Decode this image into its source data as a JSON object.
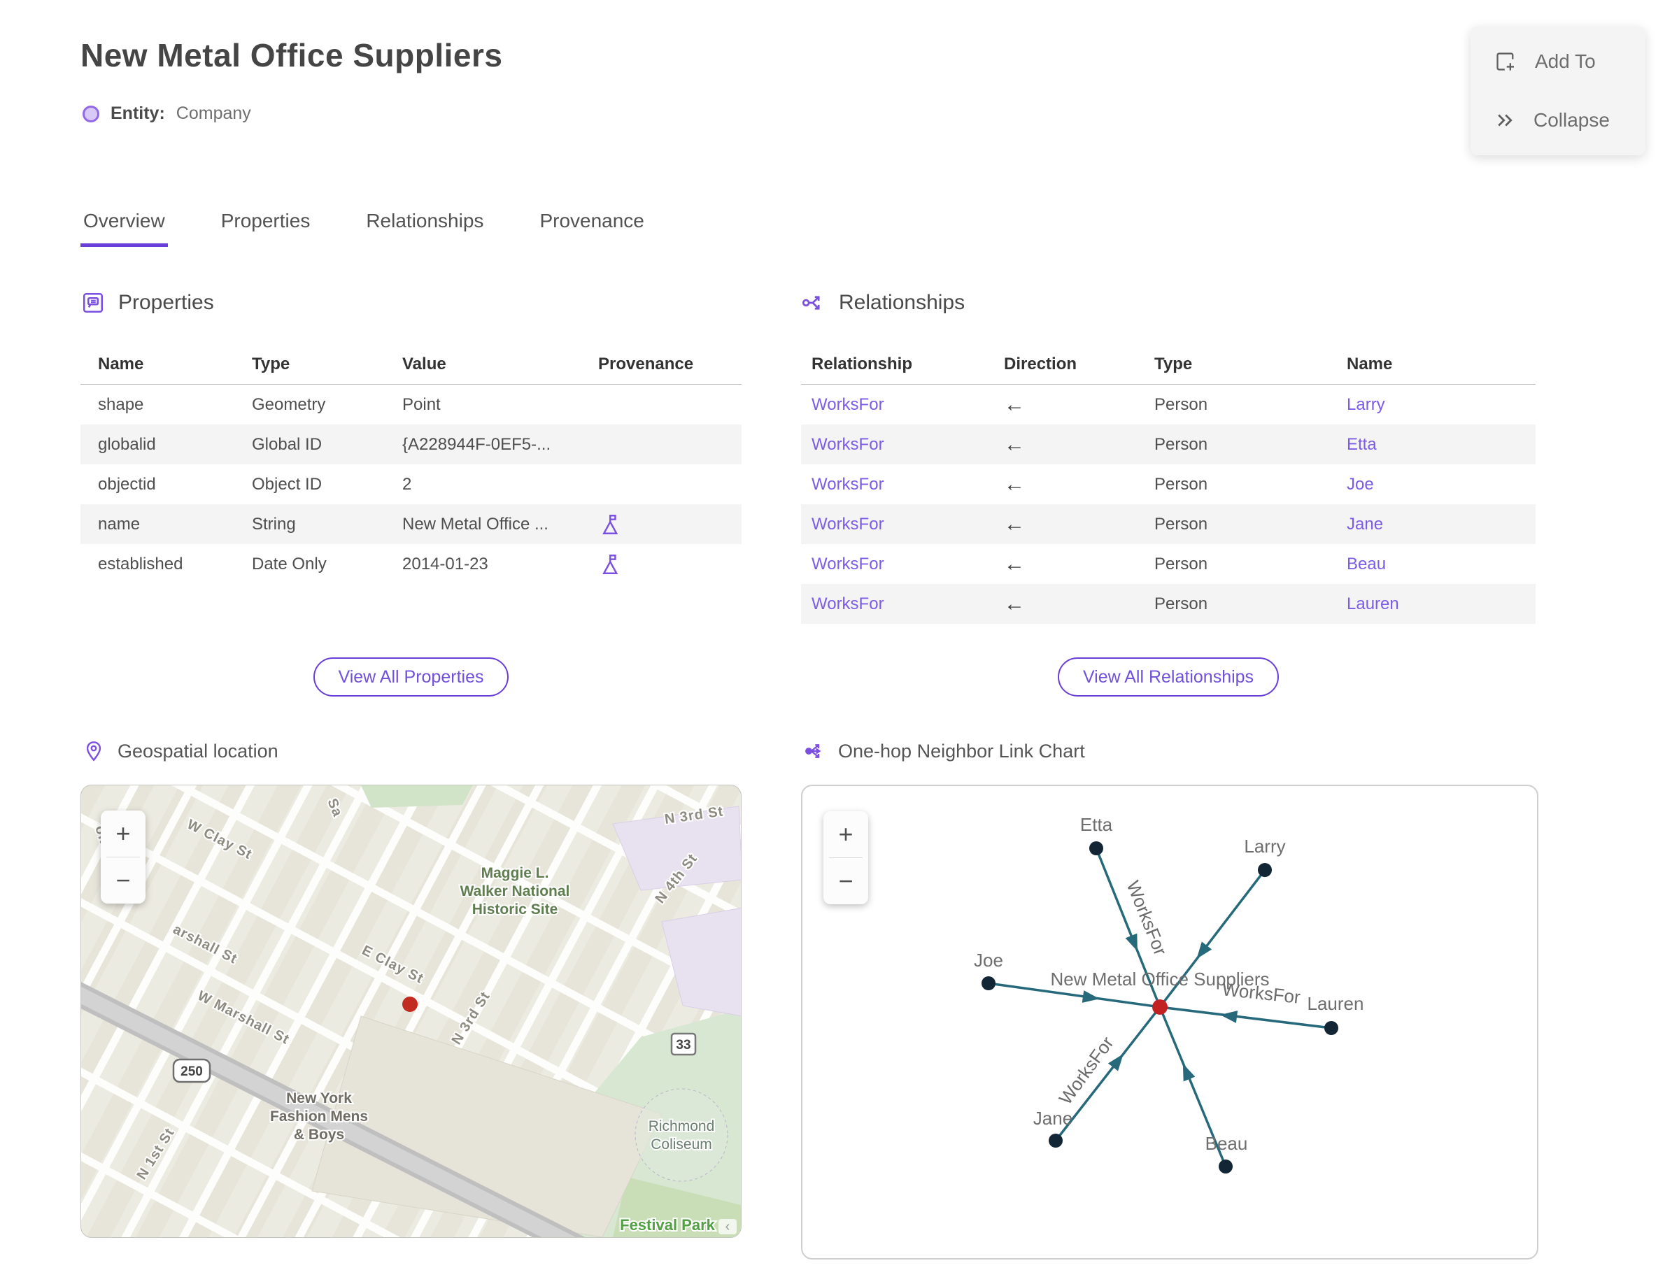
{
  "header": {
    "title": "New Metal Office Suppliers",
    "entity_label": "Entity:",
    "entity_type": "Company"
  },
  "actions": {
    "add_to": "Add To",
    "collapse": "Collapse"
  },
  "tabs": {
    "overview": "Overview",
    "properties": "Properties",
    "relationships": "Relationships",
    "provenance": "Provenance"
  },
  "properties_section": {
    "title": "Properties",
    "columns": {
      "name": "Name",
      "type": "Type",
      "value": "Value",
      "provenance": "Provenance"
    },
    "rows": [
      {
        "name": "shape",
        "type": "Geometry",
        "value": "Point"
      },
      {
        "name": "globalid",
        "type": "Global ID",
        "value": "{A228944F-0EF5-..."
      },
      {
        "name": "objectid",
        "type": "Object ID",
        "value": "2"
      },
      {
        "name": "name",
        "type": "String",
        "value": "New Metal Office ..."
      },
      {
        "name": "established",
        "type": "Date Only",
        "value": "2014-01-23"
      }
    ],
    "view_all": "View All Properties"
  },
  "relationships_section": {
    "title": "Relationships",
    "columns": {
      "relationship": "Relationship",
      "direction": "Direction",
      "type": "Type",
      "name": "Name"
    },
    "rows": [
      {
        "relationship": "WorksFor",
        "direction": "←",
        "type": "Person",
        "name": "Larry"
      },
      {
        "relationship": "WorksFor",
        "direction": "←",
        "type": "Person",
        "name": "Etta"
      },
      {
        "relationship": "WorksFor",
        "direction": "←",
        "type": "Person",
        "name": "Joe"
      },
      {
        "relationship": "WorksFor",
        "direction": "←",
        "type": "Person",
        "name": "Jane"
      },
      {
        "relationship": "WorksFor",
        "direction": "←",
        "type": "Person",
        "name": "Beau"
      },
      {
        "relationship": "WorksFor",
        "direction": "←",
        "type": "Person",
        "name": "Lauren"
      }
    ],
    "view_all": "View All Relationships"
  },
  "map_section": {
    "title": "Geospatial location",
    "zoom_in": "+",
    "zoom_out": "−",
    "marker_color": "#c22b20",
    "labels": {
      "ok_rd": "ok Rd",
      "w_clay_st": "W Clay St",
      "sa": "Sa",
      "marshall_st": "arshall St",
      "w_marshall_st": "W Marshall St",
      "e_clay_st": "E Clay St",
      "n_3rd_st_top": "N 3rd St",
      "n_4th_st": "N 4th St",
      "n_3rd_st": "N 3rd St",
      "n_1st_st": "N 1st St",
      "maggie_1": "Maggie L.",
      "maggie_2": "Walker National",
      "maggie_3": "Historic Site",
      "ny_1": "New York",
      "ny_2": "Fashion Mens",
      "ny_3": "& Boys",
      "richmond_1": "Richmond",
      "richmond_2": "Coliseum",
      "festival_park": "Festival Park",
      "route_250": "250",
      "route_33": "33"
    }
  },
  "chart_section": {
    "title": "One-hop Neighbor Link Chart",
    "zoom_in": "+",
    "zoom_out": "−",
    "center_label": "New Metal Office Suppliers",
    "edge_label": "WorksFor",
    "nodes": {
      "etta": "Etta",
      "larry": "Larry",
      "joe": "Joe",
      "lauren": "Lauren",
      "jane": "Jane",
      "beau": "Beau"
    },
    "colors": {
      "edge": "#25697b",
      "node": "#122636",
      "center_node": "#c32222"
    }
  },
  "chart_data": {
    "type": "graph",
    "center": "New Metal Office Suppliers",
    "nodes": [
      "New Metal Office Suppliers",
      "Etta",
      "Larry",
      "Joe",
      "Lauren",
      "Jane",
      "Beau"
    ],
    "edges": [
      {
        "from": "Etta",
        "to": "New Metal Office Suppliers",
        "label": "WorksFor"
      },
      {
        "from": "Larry",
        "to": "New Metal Office Suppliers",
        "label": "WorksFor"
      },
      {
        "from": "Joe",
        "to": "New Metal Office Suppliers",
        "label": "WorksFor"
      },
      {
        "from": "Lauren",
        "to": "New Metal Office Suppliers",
        "label": "WorksFor"
      },
      {
        "from": "Jane",
        "to": "New Metal Office Suppliers",
        "label": "WorksFor"
      },
      {
        "from": "Beau",
        "to": "New Metal Office Suppliers",
        "label": "WorksFor"
      }
    ]
  },
  "theme": {
    "accent": "#6a3fd7",
    "link": "#7c5ce6",
    "icon_purple": "#7b4fe0",
    "text_dark": "#474747",
    "text_gray": "#6e6e6e",
    "stripe": "#f4f4f4"
  }
}
